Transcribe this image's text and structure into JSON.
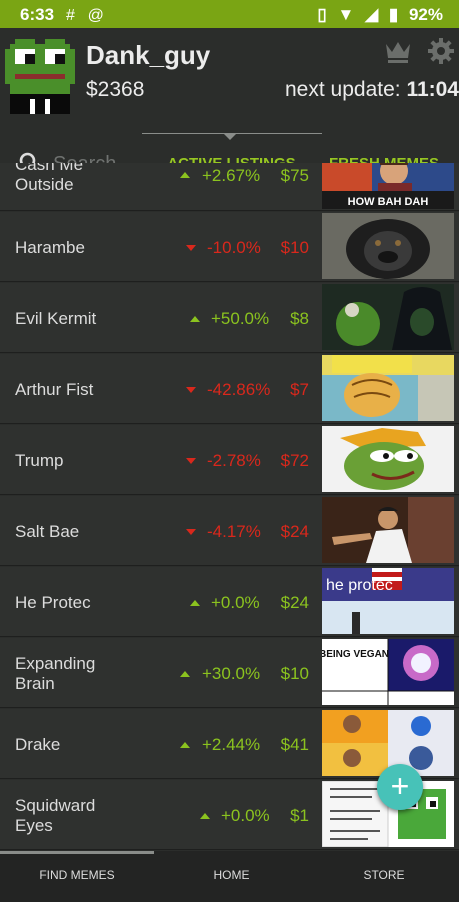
{
  "status_bar": {
    "time": "6:33",
    "battery": "92%"
  },
  "profile": {
    "username": "Dank_guy",
    "balance": "$2368",
    "next_update_label": "next update:",
    "next_update_time": "11:04"
  },
  "tabs": {
    "search_placeholder": "Search",
    "active_listings": "ACTIVE LISTINGS",
    "fresh_memes": "FRESH MEMES"
  },
  "listings": [
    {
      "name_line1": "Cash Me",
      "name_line2": "Outside",
      "direction": "up",
      "change": "+2.67%",
      "price": "$75",
      "thumb_text": "HOW BAH DAH"
    },
    {
      "name_line1": "Harambe",
      "name_line2": "",
      "direction": "down",
      "change": "-10.0%",
      "price": "$10",
      "thumb_text": ""
    },
    {
      "name_line1": "Evil Kermit",
      "name_line2": "",
      "direction": "up",
      "change": "+50.0%",
      "price": "$8",
      "thumb_text": ""
    },
    {
      "name_line1": "Arthur Fist",
      "name_line2": "",
      "direction": "down",
      "change": "-42.86%",
      "price": "$7",
      "thumb_text": ""
    },
    {
      "name_line1": "Trump",
      "name_line2": "",
      "direction": "down",
      "change": "-2.78%",
      "price": "$72",
      "thumb_text": ""
    },
    {
      "name_line1": "Salt Bae",
      "name_line2": "",
      "direction": "down",
      "change": "-4.17%",
      "price": "$24",
      "thumb_text": ""
    },
    {
      "name_line1": "He Protec",
      "name_line2": "",
      "direction": "up",
      "change": "+0.0%",
      "price": "$24",
      "thumb_text": "he protec"
    },
    {
      "name_line1": "Expanding",
      "name_line2": "Brain",
      "direction": "up",
      "change": "+30.0%",
      "price": "$10",
      "thumb_text": "BEING VEGAN"
    },
    {
      "name_line1": "Drake",
      "name_line2": "",
      "direction": "up",
      "change": "+2.44%",
      "price": "$41",
      "thumb_text": ""
    },
    {
      "name_line1": "Squidward",
      "name_line2": "Eyes",
      "direction": "up",
      "change": "+0.0%",
      "price": "$1",
      "thumb_text": ""
    }
  ],
  "fab": {
    "label": "+"
  },
  "bottom_nav": {
    "find_memes": "FIND MEMES",
    "home": "HOME",
    "store": "STORE"
  },
  "colors": {
    "status_bar": "#7aa514",
    "accent_green": "#97c722",
    "positive": "#8bc31f",
    "negative": "#d9281c",
    "fab": "#47c2b8",
    "background": "#2b2d2b"
  },
  "icons": [
    "slack-icon",
    "at-sign-icon",
    "vibrate-icon",
    "wifi-icon",
    "signal-icon",
    "battery-icon",
    "crown-icon",
    "gear-icon",
    "search-icon",
    "add-icon"
  ]
}
